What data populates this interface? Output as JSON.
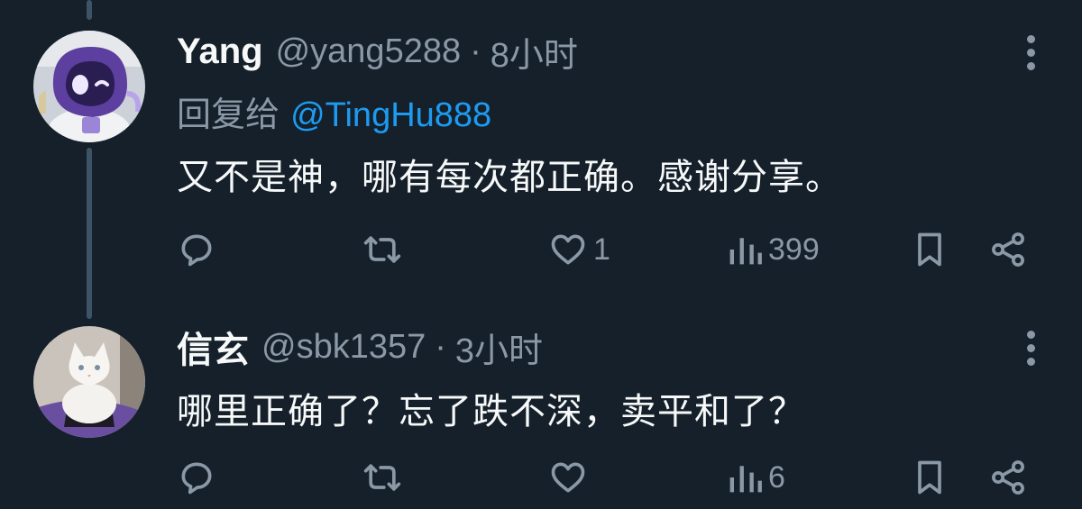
{
  "tweets": [
    {
      "name": "Yang",
      "handle": "@yang5288",
      "separator": "·",
      "time": "8小时",
      "reply_prefix": "回复给",
      "reply_mention": "@TingHu888",
      "text": "又不是神，哪有每次都正确。感谢分享。",
      "likes": "1",
      "views": "399",
      "avatar_icon": "purple-cartoon-character-avatar"
    },
    {
      "name": "信玄",
      "handle": "@sbk1357",
      "separator": "·",
      "time": "3小时",
      "text": "哪里正确了？忘了跌不深，卖平和了？",
      "likes": "",
      "views": "6",
      "avatar_icon": "white-cat-avatar"
    }
  ],
  "colors": {
    "background": "#15202b",
    "text": "#f7f9f9",
    "secondary": "#8b98a5",
    "accent": "#1d9bf0",
    "thread_line": "#3d5466"
  }
}
